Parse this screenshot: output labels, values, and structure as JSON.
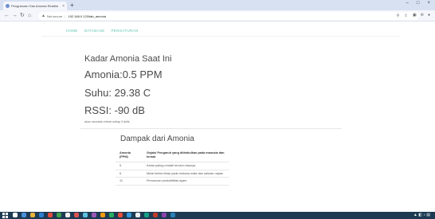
{
  "browser": {
    "tab_title": "Pengukuran Gas Amonia Realtim",
    "tab_close": "×",
    "new_tab": "+",
    "window_controls": [
      "–",
      "□",
      "×"
    ],
    "security_label": "Not secure",
    "url": "192.168.0.120/tab_amonia"
  },
  "nav": {
    "items": [
      "HOME",
      "DATABASE",
      "PENGATURAN"
    ]
  },
  "readings": {
    "title": "Kadar Amonia Saat Ini",
    "amonia": "Amonia:0.5 PPM",
    "suhu": "Suhu: 29.38 C",
    "rssi": "RSSI: -90 dB",
    "refresh_note": "akan otomatis refresh setiap 5 detik"
  },
  "dampak": {
    "title": "Dampak dari Amonia",
    "headers": [
      "Amonia (PPM)",
      "Gejala/ Pengaruh yang ditimbulkan pada manusia dan ternak"
    ],
    "rows": [
      [
        "5",
        "Kadar paling rendah tercium baunya"
      ],
      [
        "6",
        "Mulai timbul iritasi pada mukosa mata dan saluran napas"
      ],
      [
        "11",
        "Penurunan produktifitas ayam"
      ]
    ]
  },
  "colors": {
    "nav_accent": "#5cc2b0",
    "taskbar": "#1d3a52",
    "tab_strip": "#d8e1f2"
  }
}
